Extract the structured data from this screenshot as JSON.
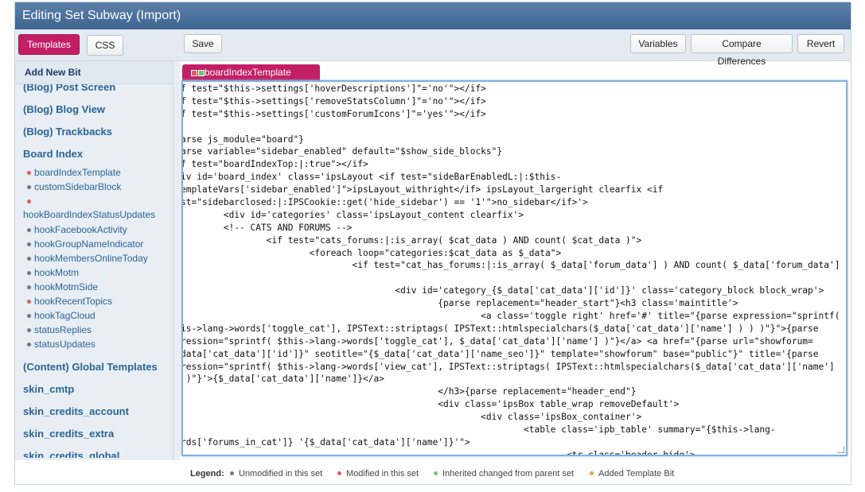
{
  "window": {
    "title": "Editing Set Subway (Import)"
  },
  "toolbar": {
    "templates": "Templates",
    "css": "CSS",
    "save": "Save",
    "variables": "Variables",
    "compare": "Compare Differences",
    "revert": "Revert"
  },
  "sidebar": {
    "add_new_bit": "Add New Bit",
    "groups_top": [
      "(Blog) Post Screen",
      "(Blog) Blog View",
      "(Blog) Trackbacks",
      "Board Index"
    ],
    "bits": [
      {
        "label": "boardIndexTemplate",
        "status": "modified"
      },
      {
        "label": "customSidebarBlock",
        "status": "unmodified"
      },
      {
        "label": "hookBoardIndexStatusUpdates",
        "status": "modified"
      },
      {
        "label": "hookFacebookActivity",
        "status": "unmodified"
      },
      {
        "label": "hookGroupNameIndicator",
        "status": "unmodified"
      },
      {
        "label": "hookMembersOnlineToday",
        "status": "unmodified"
      },
      {
        "label": "hookMotm",
        "status": "unmodified"
      },
      {
        "label": "hookMotmSide",
        "status": "unmodified"
      },
      {
        "label": "hookRecentTopics",
        "status": "modified"
      },
      {
        "label": "hookTagCloud",
        "status": "unmodified"
      },
      {
        "label": "statusReplies",
        "status": "unmodified"
      },
      {
        "label": "statusUpdates",
        "status": "unmodified"
      }
    ],
    "groups_bottom": [
      "(Content) Global Templates",
      "skin_cmtp",
      "skin_credits_account",
      "skin_credits_extra",
      "skin_credits_global"
    ]
  },
  "editor": {
    "tab": "boardIndexTemplate",
    "lines": [
      "f test=\"$this->settings['hoverDescriptions']\"='no'\"></if>",
      "f test=\"$this->settings['removeStatsColumn']\"='no'\"></if>",
      "f test=\"$this->settings['customForumIcons']\"='yes'\"></if>",
      "",
      "arse js_module=\"board\"}",
      "arse variable=\"sidebar_enabled\" default=\"$show_side_blocks\"}",
      "f test=\"boardIndexTop:|:true\"></if>",
      "iv id='board_index' class='ipsLayout <if test=\"sideBarEnabledL:|:$this-",
      "emplateVars['sidebar_enabled']\">ipsLayout_withright</if> ipsLayout_largeright clearfix <if",
      "st=\"sidebarclosed:|:IPSCookie::get('hide_sidebar') == '1'\">no_sidebar</if>'>",
      "        <div id='categories' class='ipsLayout_content clearfix'>",
      "        <!-- CATS AND FORUMS -->",
      "                <if test=\"cats_forums:|:is_array( $cat_data ) AND count( $cat_data )\">",
      "                        <foreach loop=\"categories:$cat_data as $_data\">",
      "                                <if test=\"cat_has_forums:|:is_array( $_data['forum_data'] ) AND count( $_data['forum_data']",
      "",
      "                                        <div id='category_{$_data['cat_data']['id']}' class='category_block block_wrap'>",
      "                                                {parse replacement=\"header_start\"}<h3 class='maintitle'>",
      "                                                        <a class='toggle right' href='#' title=\"{parse expression=\"sprintf(",
      "is->lang->words['toggle_cat'], IPSText::striptags( IPSText::htmlspecialchars($_data['cat_data']['name'] ) ) )\"}\">{parse",
      "ression=\"sprintf( $this->lang->words['toggle_cat'], $_data['cat_data']['name'] )\"}</a> <a href=\"{parse url=\"showforum=",
      "data['cat_data']['id']}\" seotitle=\"{$_data['cat_data']['name_seo']}\" template=\"showforum\" base=\"public\"}\" title='{parse",
      "ression=\"sprintf( $this->lang->words['view_cat'], IPSText::striptags( IPSText::htmlspecialchars($_data['cat_data']['name']",
      " )\"}'>{$_data['cat_data']['name']}</a>",
      "                                                </h3>{parse replacement=\"header_end\"}",
      "                                                <div class='ipsBox table_wrap removeDefault'>",
      "                                                        <div class='ipsBox_container'>",
      "                                                                <table class='ipb_table' summary=\"{$this->lang-",
      "rds['forums_in_cat']} '{$_data['cat_data']['name']}'\">",
      "                                                                        <tr class='header hide'>"
    ]
  },
  "legend": {
    "title": "Legend:",
    "items": [
      {
        "label": "Unmodified in this set",
        "color": "#777777"
      },
      {
        "label": "Modified in this set",
        "color": "#e25c5c"
      },
      {
        "label": "Inherited changed from parent set",
        "color": "#6cc56c"
      },
      {
        "label": "Added Template Bit",
        "color": "#f0a030"
      }
    ]
  },
  "colors": {
    "accent": "#c21e66",
    "title_bar": "#4a6e98",
    "link": "#2a6496"
  }
}
